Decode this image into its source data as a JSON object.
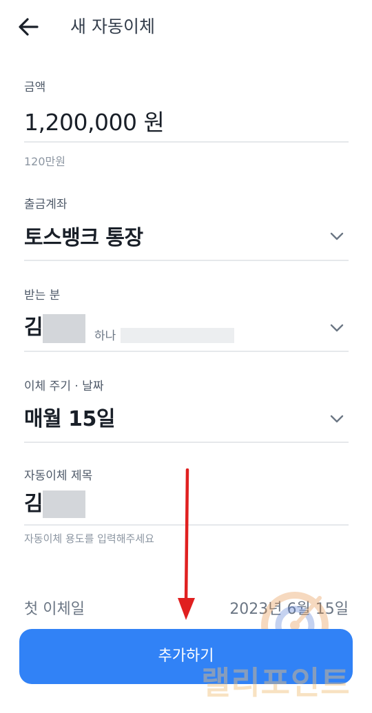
{
  "header": {
    "title": "새 자동이체"
  },
  "amount": {
    "label": "금액",
    "value": "1,200,000 원",
    "helper": "120만원"
  },
  "account": {
    "label": "출금계좌",
    "value": "토스뱅크 통장"
  },
  "recipient": {
    "label": "받는 분",
    "name": "김",
    "bank": "하나"
  },
  "schedule": {
    "label": "이체 주기 · 날짜",
    "value": "매월 15일"
  },
  "memo": {
    "label": "자동이체 제목",
    "value": "김",
    "helper": "자동이체 용도를 입력해주세요"
  },
  "first_transfer": {
    "label": "첫 이체일",
    "value": "2023년 6월 15일"
  },
  "submit": {
    "label": "추가하기"
  },
  "watermark": {
    "text": "랠리포인트"
  },
  "colors": {
    "primary": "#3182f6",
    "annotation_arrow": "#e02020"
  }
}
